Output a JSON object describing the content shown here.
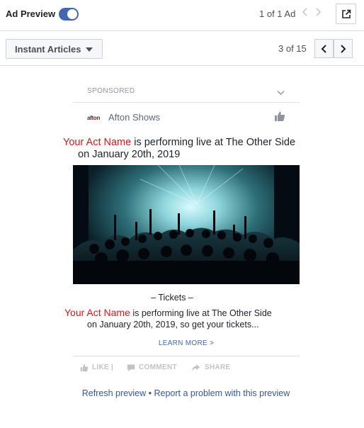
{
  "topbar": {
    "ad_preview_label": "Ad Preview",
    "ad_preview_enabled": true,
    "ad_count": "1 of 1 Ad"
  },
  "format_bar": {
    "format_label": "Instant Articles",
    "position": "3 of 15"
  },
  "card": {
    "sponsored_label": "SPONSORED",
    "publisher_logo": [
      "aft",
      "o",
      "n"
    ],
    "publisher_name": "Afton Shows",
    "headline_highlight": "Your Act Name",
    "headline_line1": " is performing live at The Other Side",
    "headline_line2": "on January 20th, 2019",
    "image_alt": "Concert crowd",
    "tickets_heading": "– Tickets –",
    "body_highlight": "Your Act Name",
    "body_line1": " is performing live at The Other Side",
    "body_line2": "on January 20th, 2019, so get your tickets...",
    "learn_more": "LEARN MORE >",
    "actions": {
      "like": "LIKE |",
      "comment": "COMMENT",
      "share": "SHARE"
    }
  },
  "footer": {
    "refresh_label": "Refresh preview",
    "separator": "•",
    "report_label": "Report a problem with this preview"
  },
  "colors": {
    "accent": "#4267b2",
    "highlight_red": "#e4141b",
    "link": "#365899"
  }
}
